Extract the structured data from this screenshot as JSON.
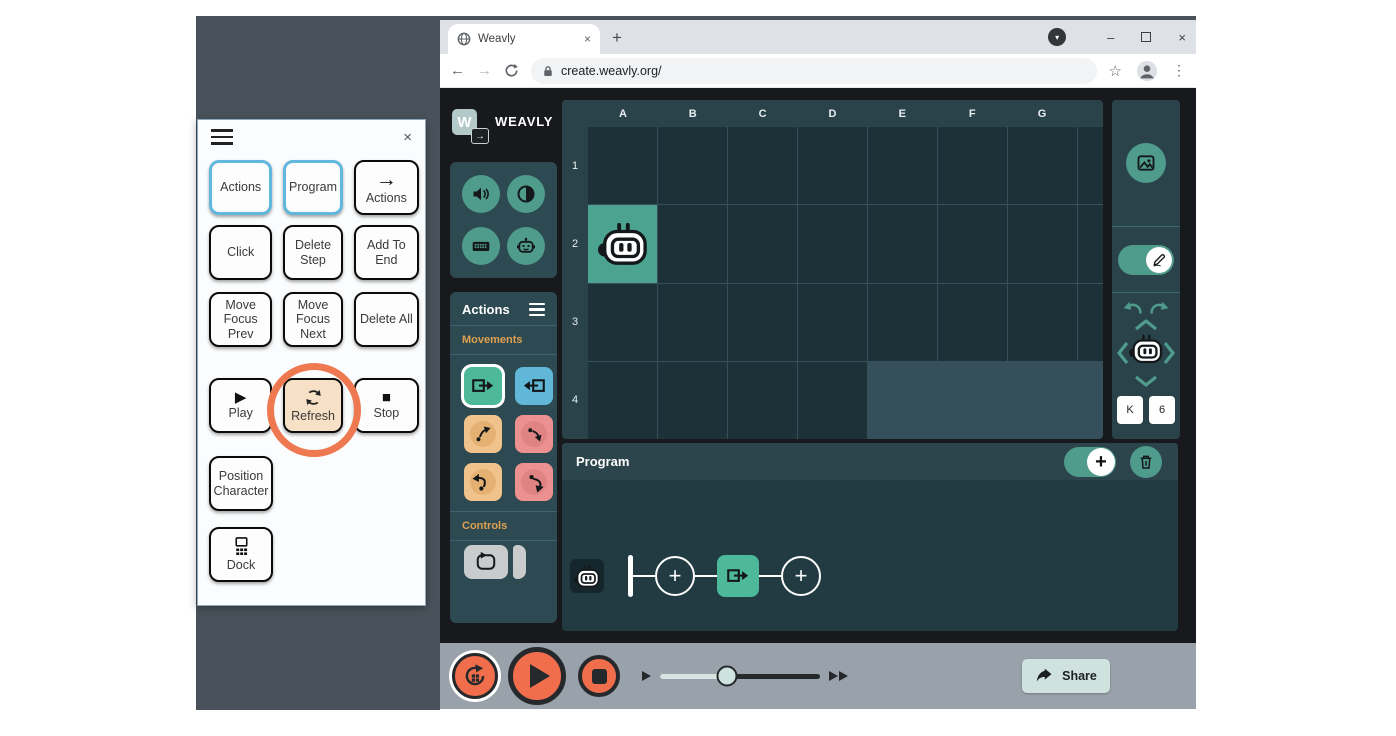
{
  "browser": {
    "tab_title": "Weavly",
    "url": "create.weavly.org/"
  },
  "glyphs": {
    "close": "×",
    "plus": "+",
    "minimize": "–",
    "menu_dots": "⋮",
    "star": "☆",
    "back_arrow": "←",
    "forward_arrow": "→",
    "play": "▶",
    "stop": "■",
    "arrow_right": "→",
    "chevron_down": "▾"
  },
  "overlay": {
    "buttons": [
      {
        "label": "Actions",
        "style": "blue"
      },
      {
        "label": "Program",
        "style": "blue"
      },
      {
        "label": "Actions",
        "icon": "arrow-right-icon"
      },
      {
        "label": "Click"
      },
      {
        "label": "Delete Step"
      },
      {
        "label": "Add To End"
      },
      {
        "label": "Move Focus Prev"
      },
      {
        "label": "Move Focus Next"
      },
      {
        "label": "Delete All"
      },
      {
        "label": "Play",
        "icon": "play-icon"
      },
      {
        "label": "Refresh",
        "icon": "refresh-icon",
        "highlighted": true
      },
      {
        "label": "Stop",
        "icon": "stop-icon"
      },
      {
        "label": "Position Character"
      },
      {
        "label": "Dock",
        "icon": "dock-icon"
      }
    ],
    "annotation_ring_color": "#ee7950"
  },
  "weavly": {
    "logo_text": "WEAVLY",
    "actions_panel": {
      "title": "Actions",
      "movements_label": "Movements",
      "controls_label": "Controls",
      "movement_blocks": [
        {
          "name": "move-forward",
          "color": "#4db998",
          "selected": true
        },
        {
          "name": "move-backward",
          "color": "#60b7d8"
        },
        {
          "name": "turn-left-45",
          "color": "#f1c38c"
        },
        {
          "name": "turn-right-45",
          "color": "#ec9191"
        },
        {
          "name": "turn-left-90",
          "color": "#f1c38c"
        },
        {
          "name": "turn-right-90",
          "color": "#ec9191"
        }
      ],
      "control_blocks": [
        {
          "name": "loop",
          "color": "#c9cbcd"
        }
      ]
    },
    "scene": {
      "columns": [
        "A",
        "B",
        "C",
        "D",
        "E",
        "F",
        "G"
      ],
      "rows": [
        "1",
        "2",
        "3",
        "4"
      ],
      "character_cell": "A2"
    },
    "sidebar": {
      "position_column": "K",
      "position_row": "6"
    },
    "program_panel": {
      "title": "Program",
      "steps": [
        {
          "name": "move-forward",
          "color": "#4db998"
        }
      ]
    },
    "bottom_bar": {
      "share_label": "Share"
    }
  },
  "colors": {
    "backdrop": "#49525a",
    "app_background": "#17191c",
    "panel_teal_dark": "#2d4a52",
    "scene_panel": "#2a434b",
    "scene_cell": "#1d3138",
    "scene_highlight": "#4ba390",
    "accent_teal": "#4f9b8c",
    "section_label_amber": "#dfa04f",
    "orange_play": "#f16e4c",
    "bottom_bar_gray": "#99a1aa",
    "share_bg": "#cfe2dd",
    "overlay_blue_border": "#62b7de",
    "refresh_highlight_bg": "#f6e0c6",
    "annotation_orange": "#ee7950"
  }
}
